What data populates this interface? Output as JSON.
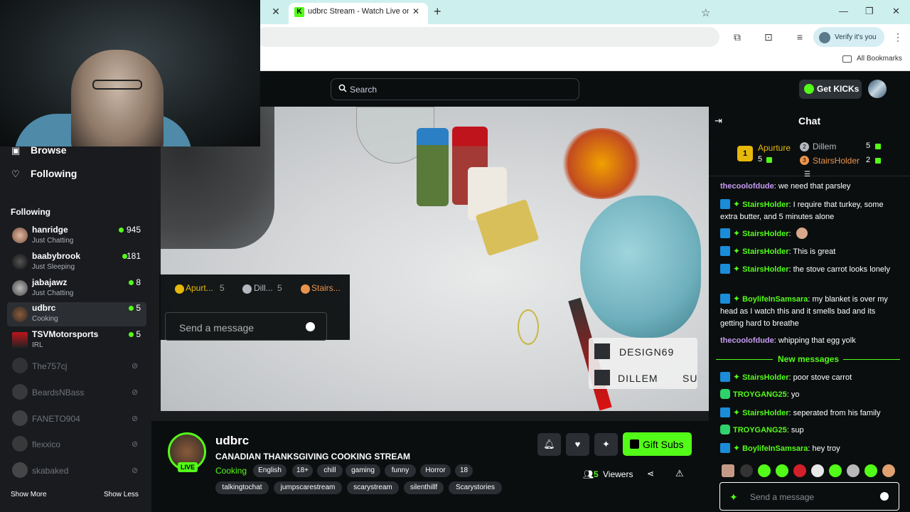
{
  "browser": {
    "tab_title": "udbrc Stream - Watch Live on K",
    "verify_label": "Verify it's you",
    "bookmarks_label": "All Bookmarks"
  },
  "header": {
    "search_placeholder": "Search",
    "get_kicks_label": "Get KICKs"
  },
  "sidebar": {
    "browse_label": "Browse",
    "following_nav_label": "Following",
    "following_header": "Following",
    "live_channels": [
      {
        "name": "hanridge",
        "category": "Just Chatting",
        "viewers": "945"
      },
      {
        "name": "baabybrook",
        "category": "Just Sleeping",
        "viewers": "181"
      },
      {
        "name": "jabajawz",
        "category": "Just Chatting",
        "viewers": "8"
      },
      {
        "name": "udbrc",
        "category": "Cooking",
        "viewers": "5"
      },
      {
        "name": "TSVMotorsports",
        "category": "IRL",
        "viewers": "5"
      }
    ],
    "offline_channels": [
      "The757cj",
      "BeardsNBass",
      "FANETO904",
      "flexxico",
      "skabaked"
    ],
    "show_more": "Show More",
    "show_less": "Show Less"
  },
  "video_overlay": {
    "mini_leaderboard": [
      "Apurt...",
      "5",
      "Dill...",
      "5",
      "Stairs..."
    ],
    "mini_input_placeholder": "Send a message",
    "subs": [
      "DESIGN69",
      "DILLEM",
      "SU"
    ]
  },
  "stream": {
    "channel_name": "udbrc",
    "live_label": "LIVE",
    "title": "CANADIAN THANKSGIVING COOKING STREAM",
    "category": "Cooking",
    "tags_row1": [
      "English",
      "18+",
      "chill",
      "gaming",
      "funny",
      "Horror",
      "18"
    ],
    "tags_row2": [
      "talkingtochat",
      "jumpscarestream",
      "scarystream",
      "silenthillf",
      "Scarystories"
    ],
    "gift_label": "Gift Subs",
    "viewers_count": "5",
    "viewers_label": "Viewers"
  },
  "chat": {
    "title": "Chat",
    "leaderboard": [
      {
        "rank": "1",
        "name": "Apurture",
        "count": "5"
      },
      {
        "rank": "2",
        "name": "Dillem",
        "count": "5"
      },
      {
        "rank": "3",
        "name": "StairsHolder",
        "count": "2"
      }
    ],
    "messages": [
      {
        "user": "thecoolofdude",
        "text": ": we need that parsley"
      },
      {
        "user": "StairsHolder",
        "text": ": I require that turkey, some extra butter, and 5 minutes alone"
      },
      {
        "user": "StairsHolder",
        "text": ":"
      },
      {
        "user": "StairsHolder",
        "text": ": This is great"
      },
      {
        "user": "StairsHolder",
        "text": ": the stove carrot looks lonely"
      },
      {
        "user": "BoylifeInSamsara",
        "text": ": my blanket is over my head as I watch this and it smells bad and its getting hard to breathe"
      },
      {
        "user": "thecoolofdude",
        "text": ": whipping that egg yolk"
      }
    ],
    "new_messages_label": "New messages",
    "new_messages": [
      {
        "user": "StairsHolder",
        "text": ": poor stove carrot"
      },
      {
        "user": "TROYGANG25",
        "text": ": yo"
      },
      {
        "user": "StairsHolder",
        "text": ": seperated from his family"
      },
      {
        "user": "TROYGANG25",
        "text": ": sup"
      },
      {
        "user": "BoylifeInSamsara",
        "text": ": hey troy"
      }
    ],
    "input_placeholder": "Send a message"
  },
  "colors": {
    "kick_green": "#53fc18",
    "gold": "#e5b80b",
    "silver": "#b5b9bf",
    "bronze": "#e9944d",
    "purple_user": "#c79cf2",
    "green_user": "#53fc18"
  }
}
